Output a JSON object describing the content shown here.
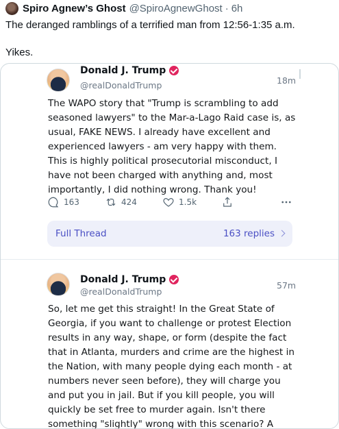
{
  "tweet": {
    "author_name": "Spiro Agnew’s Ghost",
    "author_handle": "@SpiroAgnewGhost",
    "separator": "·",
    "time": "6h",
    "text": "The deranged ramblings of a terrified man from 12:56-1:35 a.m.\n\nYikes."
  },
  "quoted_posts": [
    {
      "name": "Donald J. Trump",
      "handle": "@realDonaldTrump",
      "time": "18m",
      "body": "The WAPO story that \"Trump is scrambling to add seasoned lawyers\" to the Mar-a-Lago Raid case is, as usual, FAKE NEWS. I already have excellent and experienced lawyers - am very happy with them. This is highly political prosecutorial misconduct, I have not been charged with anything and, most importantly, I did nothing wrong. Thank you!",
      "replies": "163",
      "retruths": "424",
      "likes": "1.5k",
      "thread_label": "Full Thread",
      "replies_label": "163 replies"
    },
    {
      "name": "Donald J. Trump",
      "handle": "@realDonaldTrump",
      "time": "57m",
      "body": "So, let me get this straight! In the Great State of Georgia, if you want to challenge or protest Election results in any way, shape, or form (despite the fact that in Atlanta, murders and crime are the highest in the Nation, with many people dying each month - at numbers never seen before), they will charge you and put you in jail. But if you kill people, you will quickly be set free to murder again. Isn't there something \"slightly\" wrong with this scenario? A PERFECT PHONE CALL!"
    }
  ],
  "icons": {
    "avatar": "avatar",
    "verified": "verified-badge-icon",
    "reply": "reply-icon",
    "retruth": "retruth-icon",
    "like": "heart-icon",
    "share": "share-icon",
    "more": "more-icon",
    "chevron": "chevron-right-icon"
  },
  "colors": {
    "verified": "#e0245e",
    "thread_bg": "#eef0fa",
    "thread_text": "#4a4fc4"
  }
}
